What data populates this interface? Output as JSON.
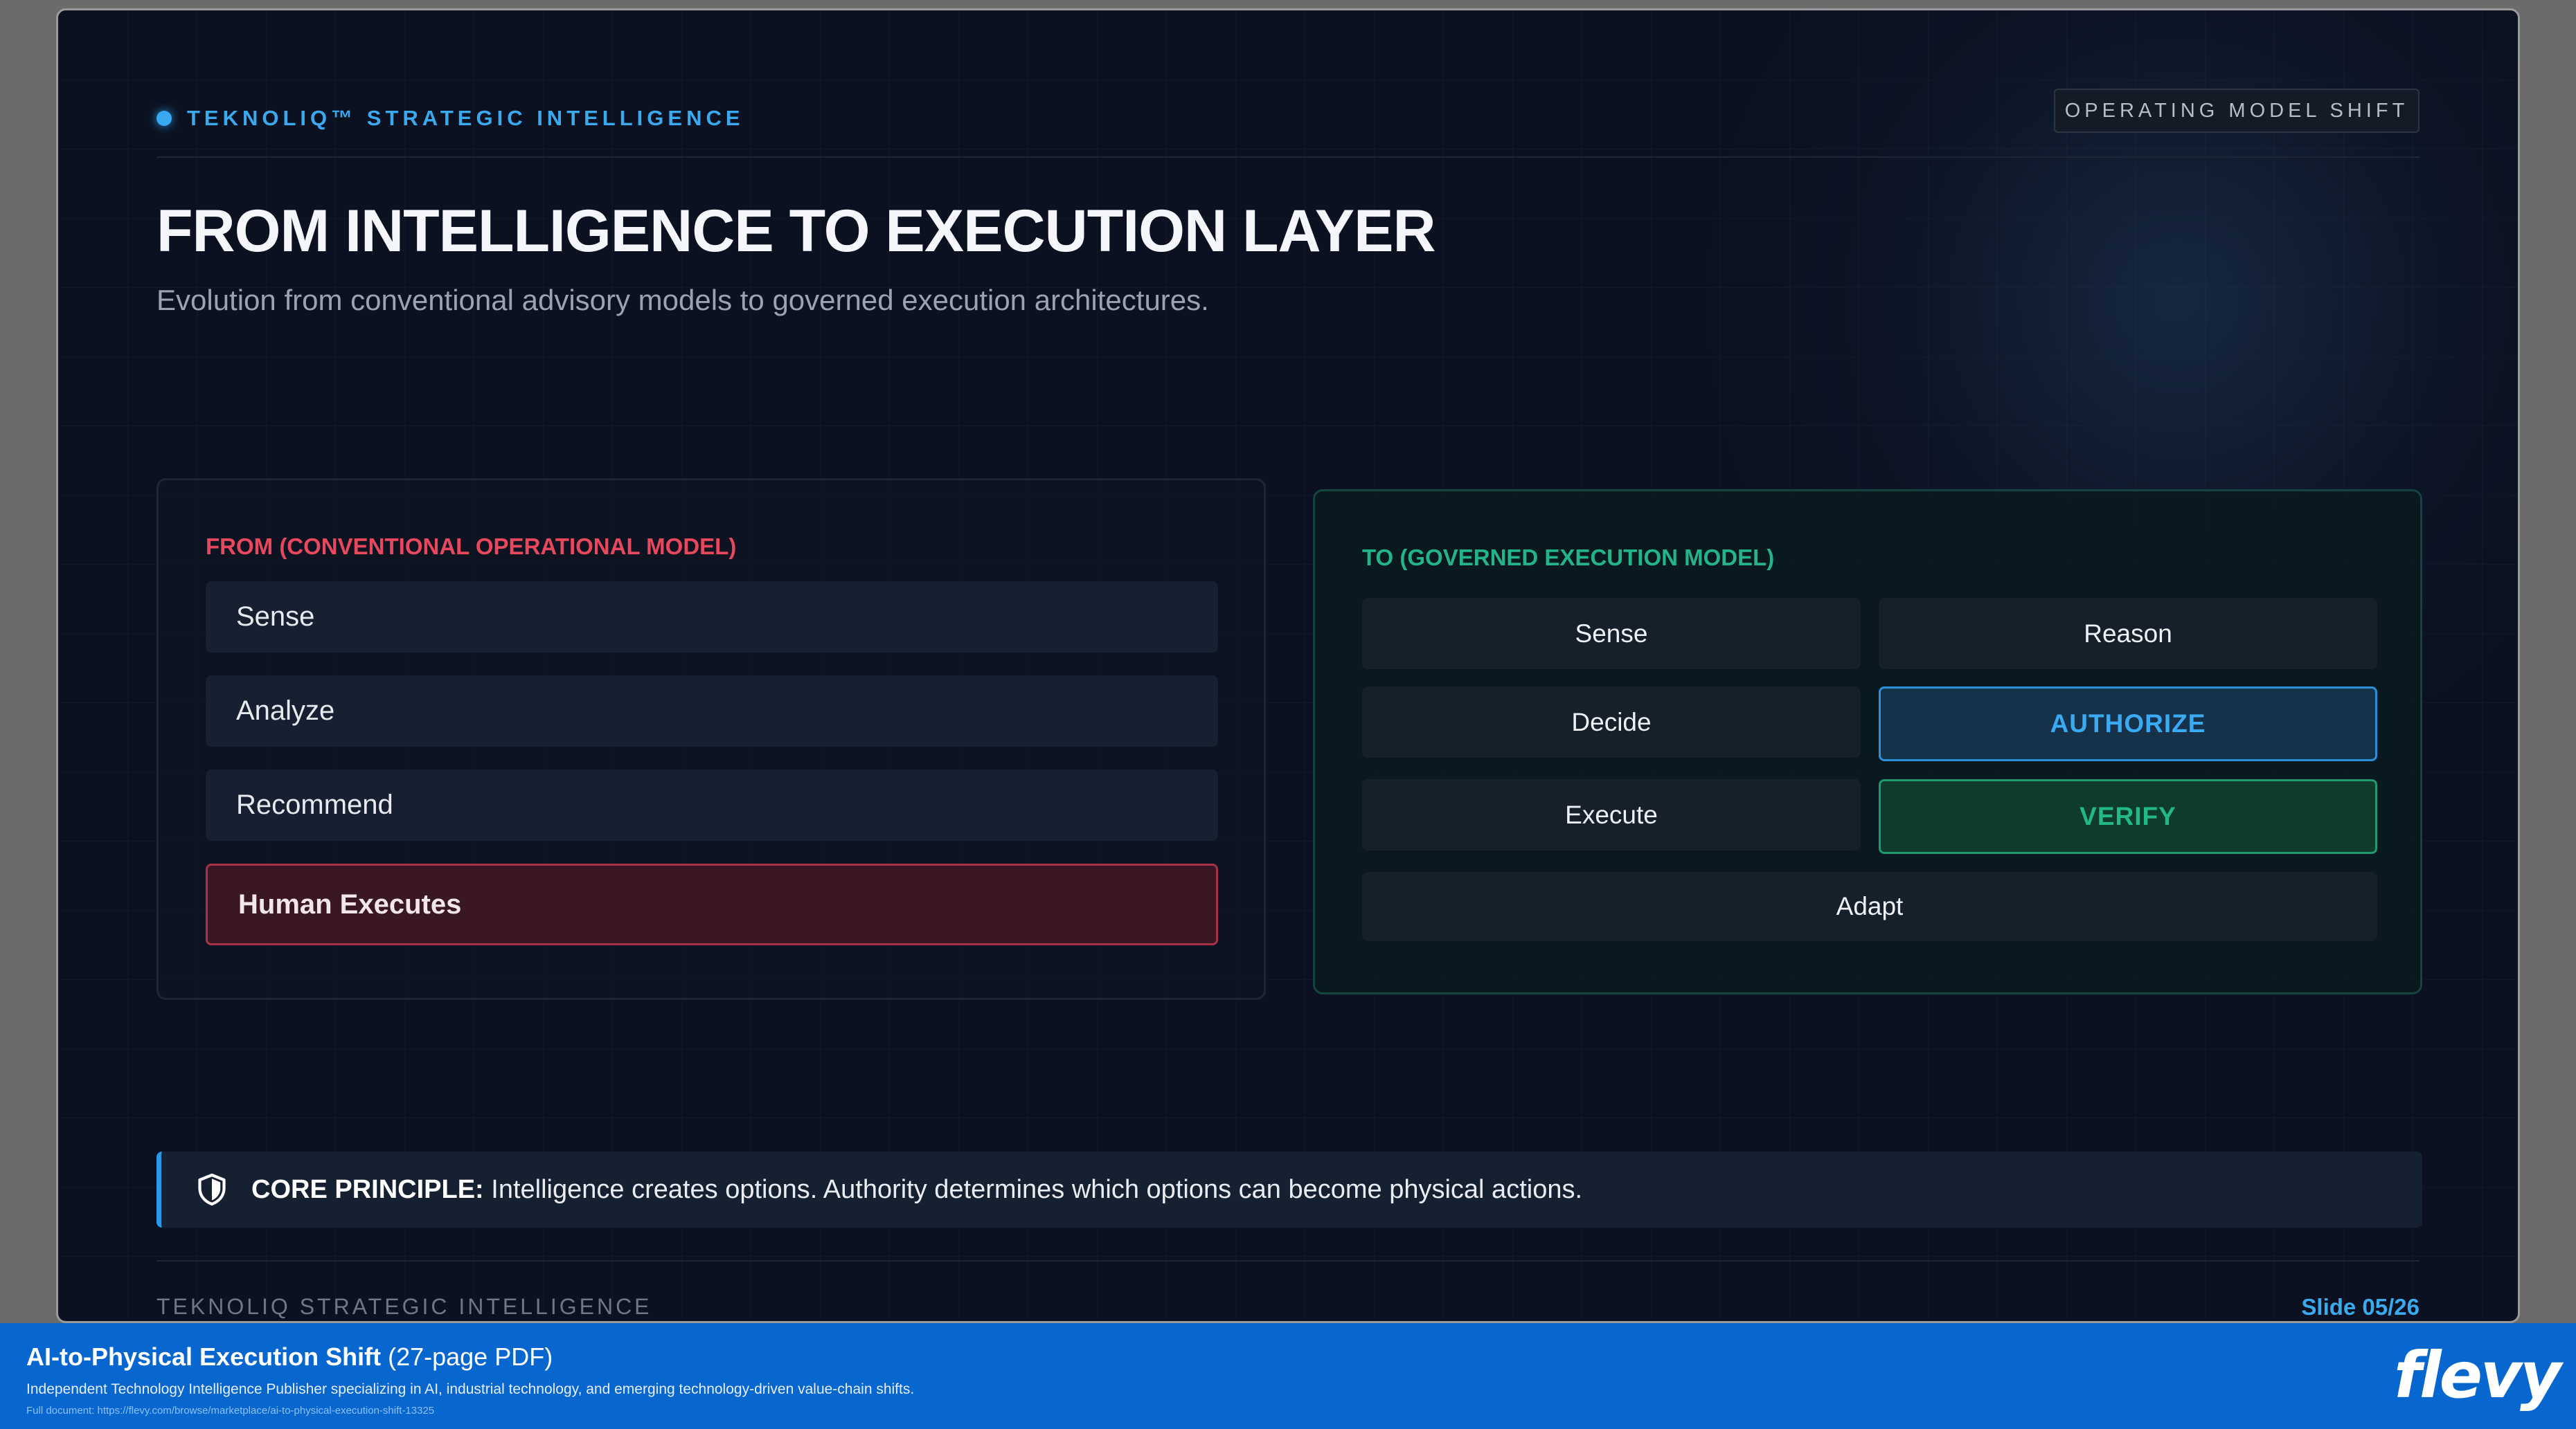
{
  "header": {
    "brand": "TEKNOLIQ™ STRATEGIC INTELLIGENCE",
    "tag": "OPERATING MODEL SHIFT"
  },
  "title": "FROM INTELLIGENCE TO EXECUTION LAYER",
  "subtitle": "Evolution from conventional advisory models to governed execution architectures.",
  "from_panel": {
    "label": "FROM (CONVENTIONAL OPERATIONAL MODEL)",
    "items": [
      "Sense",
      "Analyze",
      "Recommend",
      "Human Executes"
    ]
  },
  "to_panel": {
    "label": "TO (GOVERNED EXECUTION MODEL)",
    "items": [
      "Sense",
      "Reason",
      "Decide",
      "AUTHORIZE",
      "Execute",
      "VERIFY",
      "Adapt"
    ]
  },
  "principle": {
    "label": "CORE PRINCIPLE:",
    "text": " Intelligence creates options. Authority determines which options can become physical actions."
  },
  "footer": {
    "left": "TEKNOLIQ STRATEGIC INTELLIGENCE",
    "right": "Slide 05/26"
  },
  "banner": {
    "title": "AI-to-Physical Execution Shift",
    "pages": " (27-page PDF)",
    "description": "Independent Technology Intelligence Publisher specializing in AI, industrial technology, and emerging technology-driven value-chain shifts.",
    "link": "Full document: https://flevy.com/browse/marketplace/ai-to-physical-execution-shift-13325",
    "logo": "flevy"
  },
  "colors": {
    "accent_blue": "#3aa9ee",
    "from_red": "#e8485e",
    "to_green": "#23b48a",
    "banner_blue": "#0767cf"
  },
  "icons": {
    "principle": "shield-icon"
  }
}
